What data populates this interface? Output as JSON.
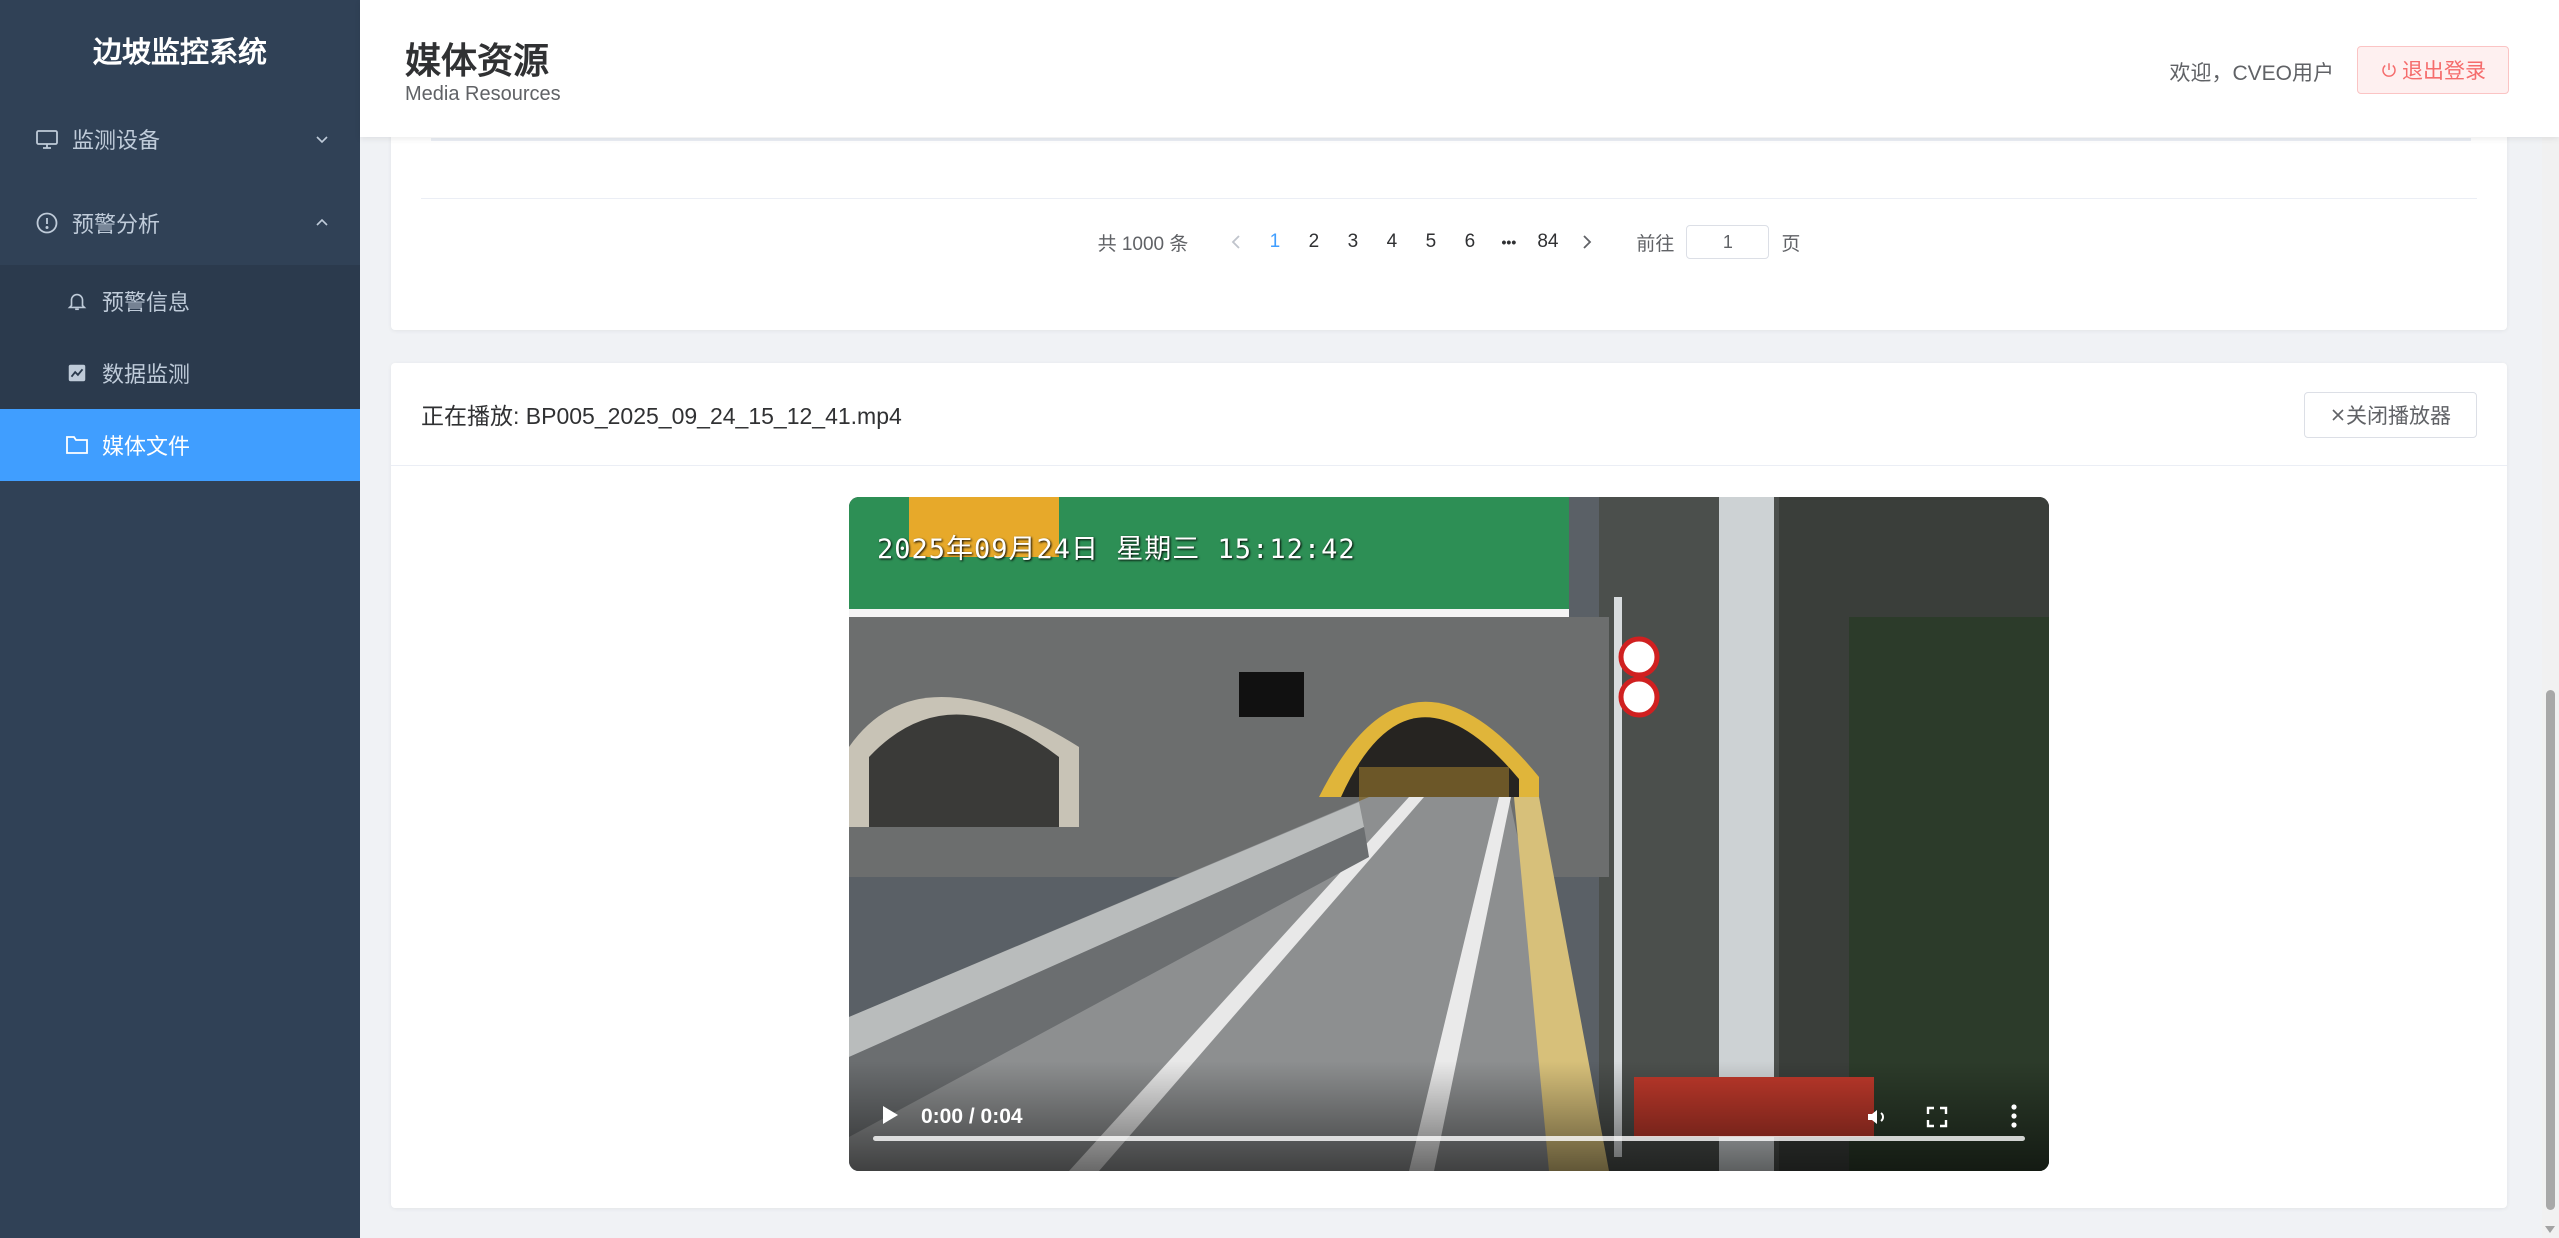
{
  "sidebar": {
    "brand": "边坡监控系统",
    "menu": [
      {
        "label": "监测设备",
        "icon": "monitor-icon",
        "expanded": false
      },
      {
        "label": "预警分析",
        "icon": "alert-circle-icon",
        "expanded": true,
        "children": [
          {
            "label": "预警信息",
            "icon": "bell-icon"
          },
          {
            "label": "数据监测",
            "icon": "chart-icon"
          },
          {
            "label": "媒体文件",
            "icon": "folder-icon",
            "active": true
          }
        ]
      }
    ]
  },
  "header": {
    "title": "媒体资源",
    "subtitle": "Media Resources",
    "welcome": "欢迎，CVEO用户",
    "logout_label": "退出登录"
  },
  "pagination": {
    "total_text": "共 1000 条",
    "pages": [
      "1",
      "2",
      "3",
      "4",
      "5",
      "6",
      "84"
    ],
    "current_page": "1",
    "ellipsis": "•••",
    "goto_label": "前往",
    "goto_value": "1",
    "page_suffix": "页"
  },
  "player": {
    "now_playing": "正在播放: BP005_2025_09_24_15_12_41.mp4",
    "close_label": "关闭播放器",
    "osd_text": "2025年09月24日  星期三  15:12:42",
    "time_text": "0:00 / 0:04",
    "progress": 0
  },
  "colors": {
    "sidebar_bg": "#304156",
    "active": "#409eff",
    "danger": "#f56c6c"
  }
}
